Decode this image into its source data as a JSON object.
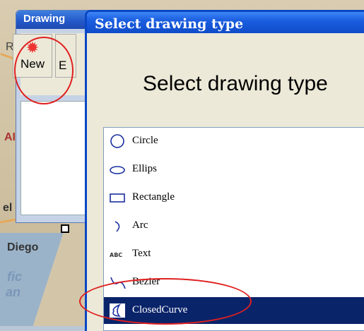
{
  "background_map": {
    "labels": [
      "Diego",
      "fic",
      "an",
      "AI",
      "el",
      "R"
    ]
  },
  "drawing_window": {
    "title": "Drawing",
    "new_button_label": "New",
    "next_button_label": "E"
  },
  "dialog": {
    "title": "Select drawing type",
    "heading": "Select drawing type",
    "items": [
      {
        "label": "Circle",
        "icon": "circle-icon"
      },
      {
        "label": "Ellips",
        "icon": "ellipse-icon"
      },
      {
        "label": "Rectangle",
        "icon": "rectangle-icon"
      },
      {
        "label": "Arc",
        "icon": "arc-icon"
      },
      {
        "label": "Text",
        "icon": "text-icon"
      },
      {
        "label": "Bezier",
        "icon": "bezier-icon"
      },
      {
        "label": "ClosedCurve",
        "icon": "closed-curve-icon"
      }
    ],
    "selected_item": "ClosedCurve"
  },
  "colors": {
    "title_bar": "#1b5ee0",
    "selection": "#0a246a",
    "icon_blue": "#1a2fa0",
    "annotation_red": "#e02020"
  }
}
